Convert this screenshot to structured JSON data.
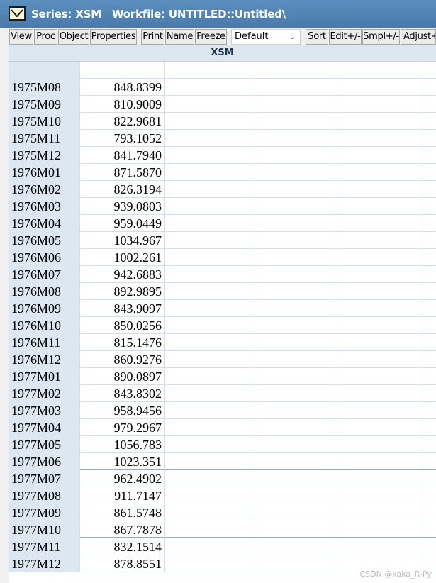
{
  "title": "Series: XSM   Workfile: UNTITLED::Untitled\\",
  "toolbar": {
    "view": "View",
    "proc": "Proc",
    "object": "Object",
    "properties": "Properties",
    "print": "Print",
    "name": "Name",
    "freeze": "Freeze",
    "select_value": "Default",
    "sort": "Sort",
    "edit": "Edit+/-",
    "smpl": "Smpl+/-",
    "adjust": "Adjust+/-"
  },
  "column_header": "XSM",
  "rows": [
    {
      "date": "1975M08",
      "value": "848.8399"
    },
    {
      "date": "1975M09",
      "value": "810.9009"
    },
    {
      "date": "1975M10",
      "value": "822.9681"
    },
    {
      "date": "1975M11",
      "value": "793.1052"
    },
    {
      "date": "1975M12",
      "value": "841.7940"
    },
    {
      "date": "1976M01",
      "value": "871.5870"
    },
    {
      "date": "1976M02",
      "value": "826.3194"
    },
    {
      "date": "1976M03",
      "value": "939.0803"
    },
    {
      "date": "1976M04",
      "value": "959.0449"
    },
    {
      "date": "1976M05",
      "value": "1034.967"
    },
    {
      "date": "1976M06",
      "value": "1002.261"
    },
    {
      "date": "1976M07",
      "value": "942.6883"
    },
    {
      "date": "1976M08",
      "value": "892.9895"
    },
    {
      "date": "1976M09",
      "value": "843.9097"
    },
    {
      "date": "1976M10",
      "value": "850.0256"
    },
    {
      "date": "1976M11",
      "value": "815.1476"
    },
    {
      "date": "1976M12",
      "value": "860.9276"
    },
    {
      "date": "1977M01",
      "value": "890.0897"
    },
    {
      "date": "1977M02",
      "value": "843.8302"
    },
    {
      "date": "1977M03",
      "value": "958.9456"
    },
    {
      "date": "1977M04",
      "value": "979.2967"
    },
    {
      "date": "1977M05",
      "value": "1056.783"
    },
    {
      "date": "1977M06",
      "value": "1023.351"
    },
    {
      "date": "1977M07",
      "value": "962.4902"
    },
    {
      "date": "1977M08",
      "value": "911.7147"
    },
    {
      "date": "1977M09",
      "value": "861.5748"
    },
    {
      "date": "1977M10",
      "value": "867.7878"
    },
    {
      "date": "1977M11",
      "value": "832.1514"
    },
    {
      "date": "1977M12",
      "value": "878.8551"
    }
  ],
  "watermark": "CSDN @kaka_R-Py"
}
